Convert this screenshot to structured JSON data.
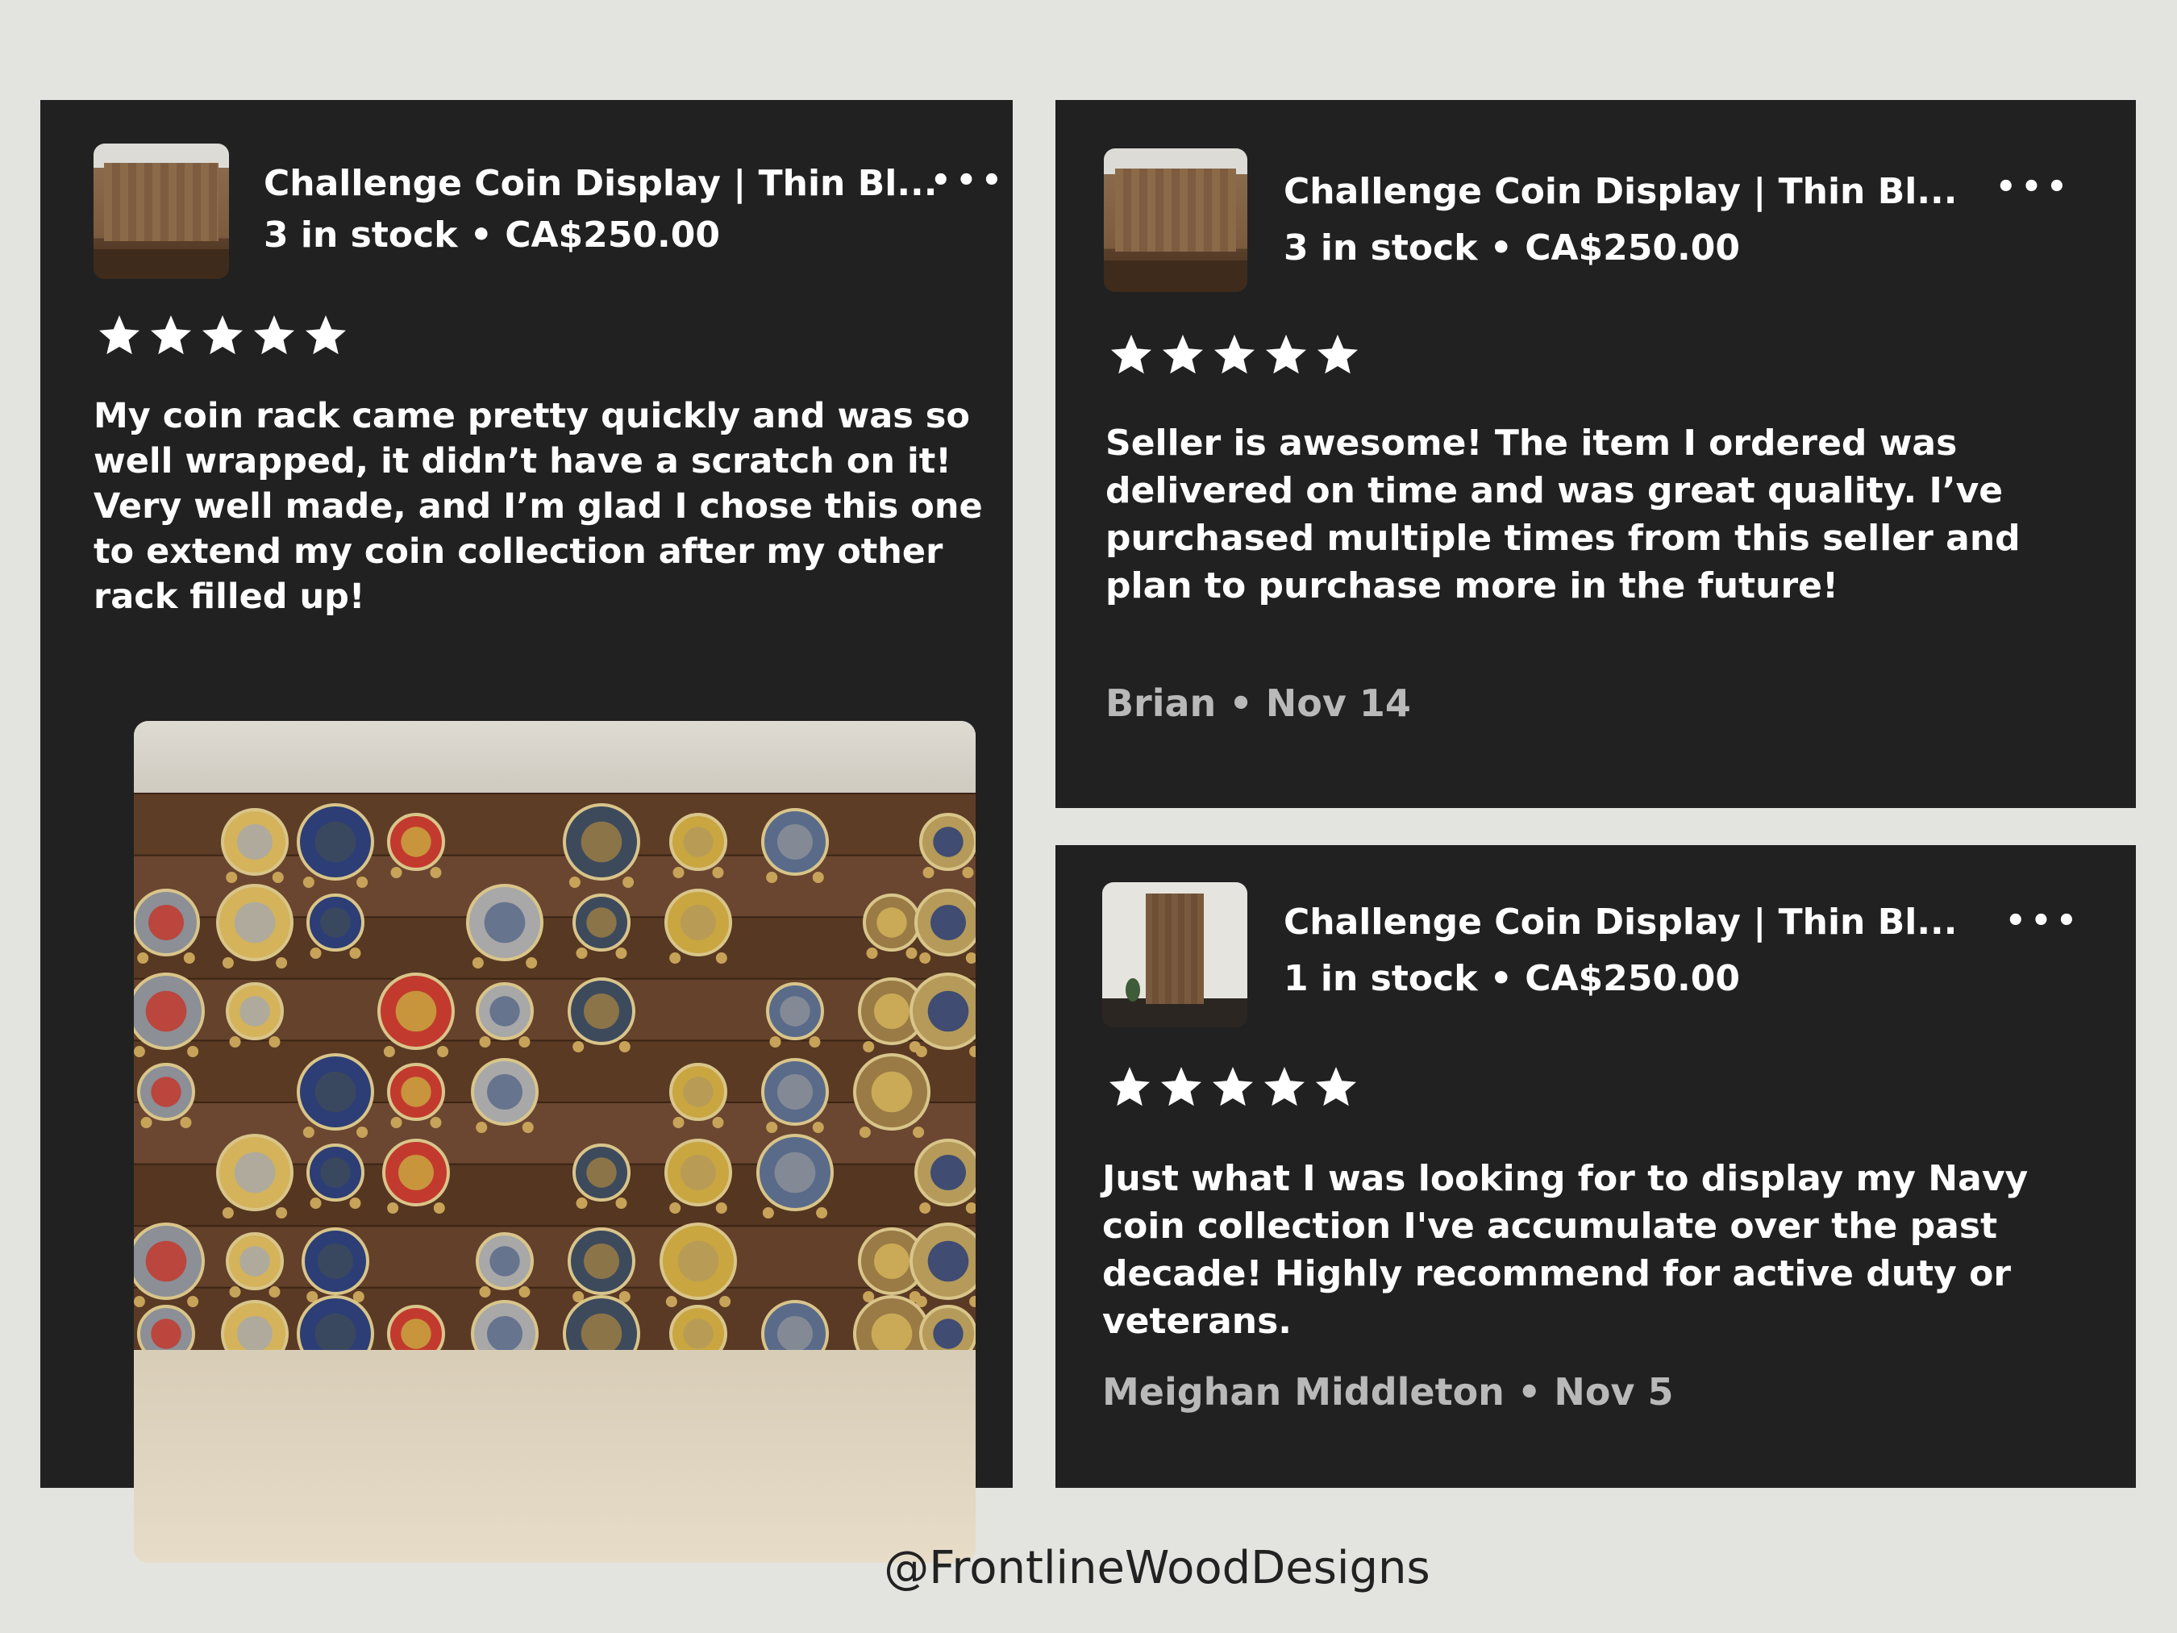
{
  "reviews": [
    {
      "listing_title": "Challenge Coin Display | Thin Bl...",
      "stock_price": "3 in stock • CA$250.00",
      "rating": 5,
      "text": "My coin rack came pretty quickly and was so well wrapped, it didn’t have a scratch on it! Very well made, and I’m glad I chose this one to extend my coin collection after my other rack filled up!",
      "more_icon": "more-horizontal-icon"
    },
    {
      "listing_title": "Challenge Coin Display | Thin Bl...",
      "stock_price": "3 in stock • CA$250.00",
      "rating": 5,
      "text": "Seller is awesome! The item I ordered was delivered on time and was great quality. I’ve purchased multiple times from this seller and plan to purchase more in the future!",
      "author_date": "Brian • Nov 14",
      "more_icon": "more-horizontal-icon"
    },
    {
      "listing_title": "Challenge Coin Display | Thin Bl...",
      "stock_price": "1 in stock • CA$250.00",
      "rating": 5,
      "text": "Just what I was looking for to display my Navy coin collection I've accumulate over the past decade! Highly recommend for active duty or veterans.",
      "author_date": "Meighan Middleton • Nov 5",
      "more_icon": "more-horizontal-icon"
    }
  ],
  "footer": {
    "handle": "@FrontlineWoodDesigns"
  },
  "colors": {
    "page_background": "#e3e4e0",
    "card_background": "#212121",
    "text_primary": "#ffffff",
    "text_secondary": "#b9b9b9",
    "star": "#ffffff"
  }
}
